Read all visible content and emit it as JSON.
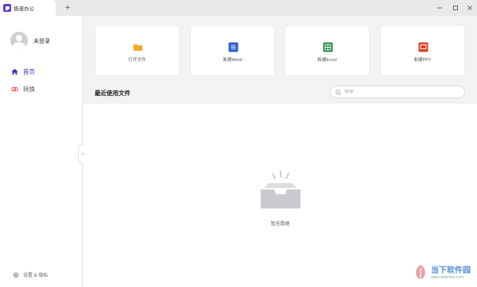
{
  "app": {
    "tab_title": "极速办公",
    "new_tab_symbol": "+"
  },
  "window_controls": {
    "minimize": "–",
    "maximize": "□",
    "close": "✕"
  },
  "sidebar": {
    "username": "未登录",
    "items": [
      {
        "label": "首页",
        "icon": "home-icon",
        "active": true
      },
      {
        "label": "转换",
        "icon": "convert-icon",
        "active": false
      }
    ],
    "settings_label": "设置 & 隐私"
  },
  "actions": [
    {
      "label": "打开文件",
      "icon": "folder-icon",
      "color": "#f5a623"
    },
    {
      "label": "新建Word",
      "icon": "word-icon",
      "color": "#2b5fc7"
    },
    {
      "label": "新建Excel",
      "icon": "excel-icon",
      "color": "#1f8a44"
    },
    {
      "label": "新建PPT",
      "icon": "ppt-icon",
      "color": "#d9452b"
    }
  ],
  "recent": {
    "title": "最近使用文件",
    "search_placeholder": "搜索",
    "empty_text": "暂无数据"
  },
  "watermark": {
    "main": "当下软件园",
    "sub": "www.downxia.com"
  },
  "colors": {
    "accent": "#3a2fc7",
    "sidebar_bg": "#ffffff",
    "page_bg": "#f3f3f5"
  }
}
